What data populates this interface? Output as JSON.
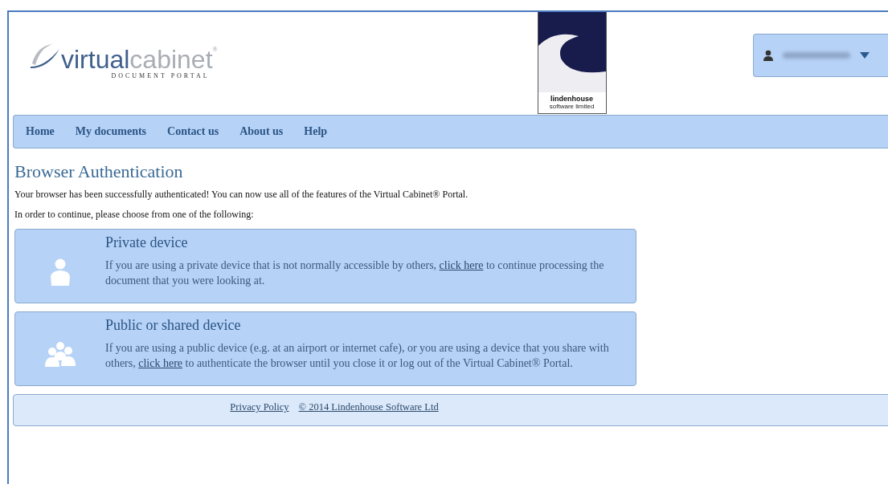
{
  "header": {
    "logo": {
      "word_1": "virtual",
      "word_2": "cabinet",
      "mark": "®",
      "tagline": "DOCUMENT PORTAL"
    },
    "partner_logo": {
      "name": "lindenhouse",
      "sub": "software limited"
    },
    "user_menu": {
      "kind": "blurred"
    }
  },
  "nav": [
    {
      "label": "Home"
    },
    {
      "label": "My documents"
    },
    {
      "label": "Contact us"
    },
    {
      "label": "About us"
    },
    {
      "label": "Help"
    }
  ],
  "page": {
    "title": "Browser Authentication",
    "paragraphs": [
      "Your browser has been successfully authenticated! You can now use all of the features of the Virtual Cabinet® Portal.",
      "In order to continue, please choose from one of the following:"
    ],
    "options": [
      {
        "kind": "single",
        "title": "Private device",
        "before": "If you are using a private device that is not normally accessible by others,",
        "link": "click here",
        "after": "to continue processing the document that you were looking at."
      },
      {
        "kind": "group",
        "title": "Public or shared device",
        "before": "If you are using a public device (e.g. at an airport or internet cafe), or you are using a device that you share with others,",
        "link": "click here",
        "after": "to authenticate the browser until you close it or log out of the Virtual Cabinet® Portal."
      }
    ]
  },
  "footer": {
    "links": [
      "Privacy Policy",
      "© 2014 Lindenhouse Software Ltd"
    ]
  }
}
